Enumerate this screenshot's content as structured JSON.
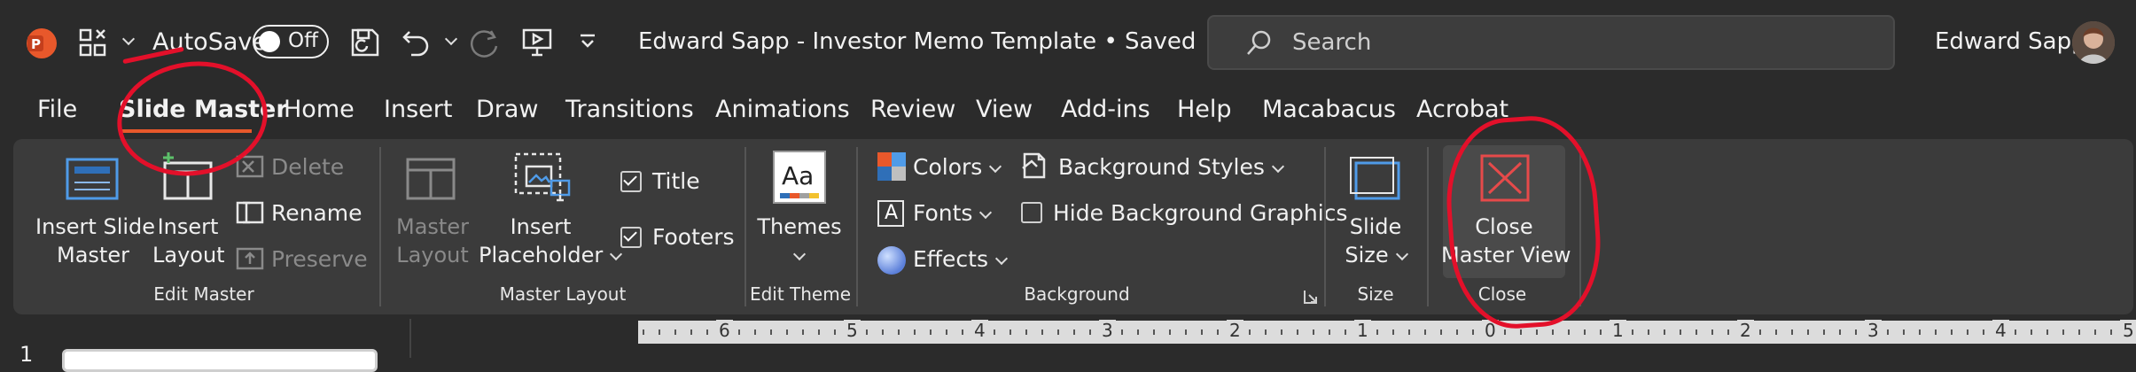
{
  "titlebar": {
    "autosave_label": "AutoSave",
    "autosave_state": "Off",
    "doc_title": "Edward Sapp - Investor Memo Template • Saved",
    "search_placeholder": "Search",
    "user_name": "Edward Sapp"
  },
  "tabs": [
    "File",
    "Slide Master",
    "Home",
    "Insert",
    "Draw",
    "Transitions",
    "Animations",
    "Review",
    "View",
    "Add-ins",
    "Help",
    "Macabacus",
    "Acrobat"
  ],
  "ribbon": {
    "edit_master": {
      "insert_slide_master": [
        "Insert Slide",
        "Master"
      ],
      "insert_layout": [
        "Insert",
        "Layout"
      ],
      "delete": "Delete",
      "rename": "Rename",
      "preserve": "Preserve",
      "group_label": "Edit Master"
    },
    "master_layout": {
      "master_layout_btn": [
        "Master",
        "Layout"
      ],
      "insert_placeholder": [
        "Insert",
        "Placeholder"
      ],
      "title_checkbox": "Title",
      "footers_checkbox": "Footers",
      "group_label": "Master Layout"
    },
    "edit_theme": {
      "themes": "Themes",
      "themes_icon_text": "Aa",
      "group_label": "Edit Theme"
    },
    "background": {
      "colors": "Colors",
      "fonts": "Fonts",
      "fonts_icon_text": "A",
      "effects": "Effects",
      "background_styles": "Background Styles",
      "hide_background_graphics": "Hide Background Graphics",
      "group_label": "Background"
    },
    "size": {
      "slide_size": [
        "Slide",
        "Size"
      ],
      "group_label": "Size"
    },
    "close": {
      "close_master_view": [
        "Close",
        "Master View"
      ],
      "group_label": "Close"
    }
  },
  "ruler": {
    "labels": [
      "6",
      "5",
      "4",
      "3",
      "2",
      "1",
      "0",
      "1",
      "2",
      "3",
      "4",
      "5"
    ]
  },
  "thumbnail_pane": {
    "slide_number": "1"
  },
  "colors": {
    "accent_orange": "#e8582b",
    "annotation_red": "#e3102a",
    "ribbon_bg": "#3b3b3b",
    "window_bg": "#2b2b2b"
  }
}
